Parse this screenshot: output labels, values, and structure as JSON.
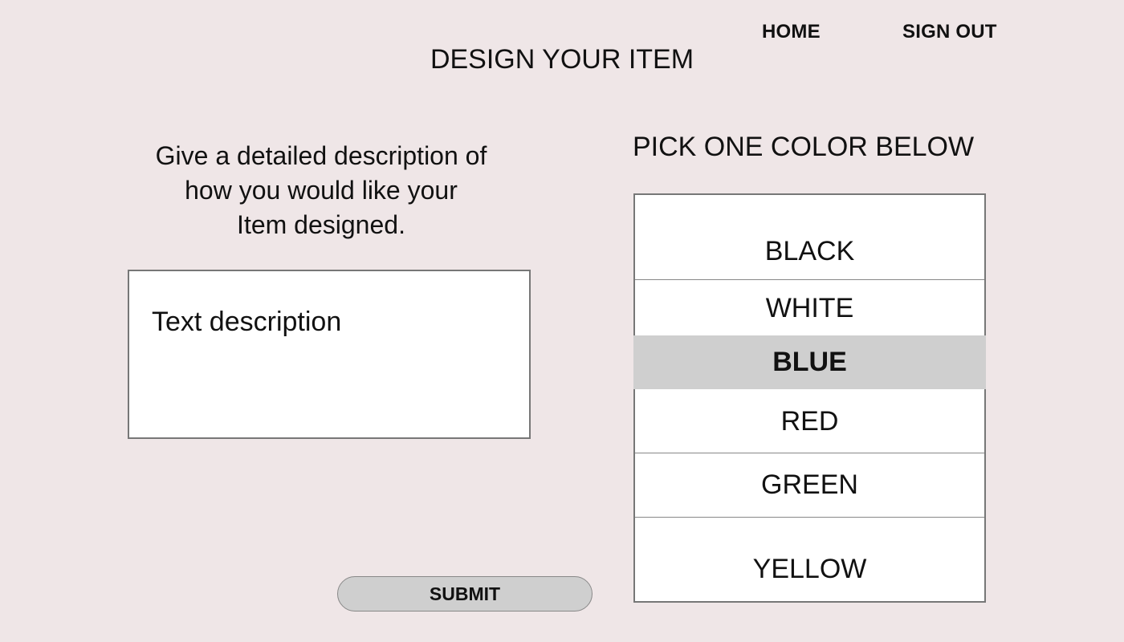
{
  "nav": {
    "home_label": "HOME",
    "signout_label": "SIGN OUT"
  },
  "page": {
    "title": "DESIGN YOUR ITEM"
  },
  "description": {
    "instructions": "Give a detailed description of\nhow you would like your\nItem designed.",
    "placeholder": "Text description",
    "value": ""
  },
  "colors": {
    "heading": "PICK ONE COLOR BELOW",
    "options": [
      {
        "label": "BLACK",
        "selected": false
      },
      {
        "label": "WHITE",
        "selected": false
      },
      {
        "label": "BLUE",
        "selected": true
      },
      {
        "label": "RED",
        "selected": false
      },
      {
        "label": "GREEN",
        "selected": false
      },
      {
        "label": "YELLOW",
        "selected": false
      }
    ]
  },
  "actions": {
    "submit_label": "SUBMIT"
  },
  "style": {
    "background": "#efe6e7",
    "selected_row": "#cfcfcf",
    "button_fill": "#cfcfcf"
  }
}
